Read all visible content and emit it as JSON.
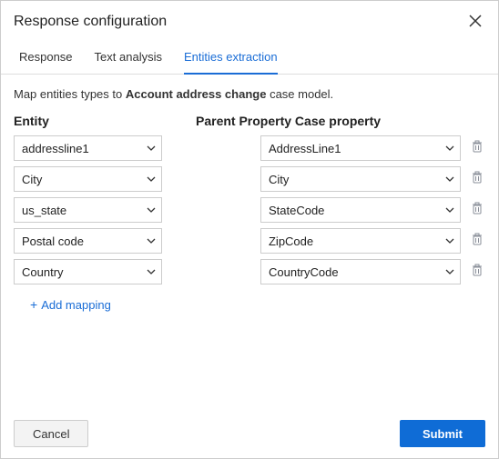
{
  "header": {
    "title": "Response configuration"
  },
  "tabs": [
    {
      "label": "Response",
      "active": false
    },
    {
      "label": "Text analysis",
      "active": false
    },
    {
      "label": "Entities extraction",
      "active": true
    }
  ],
  "body": {
    "map_text_prefix": "Map entities types to ",
    "map_text_bold": "Account address change",
    "map_text_suffix": " case model."
  },
  "columns": {
    "entity": "Entity",
    "case_property": "Parent Property Case property"
  },
  "rows": [
    {
      "entity": "addressline1",
      "case_property": "AddressLine1"
    },
    {
      "entity": "City",
      "case_property": "City"
    },
    {
      "entity": "us_state",
      "case_property": "StateCode"
    },
    {
      "entity": "Postal code",
      "case_property": "ZipCode"
    },
    {
      "entity": "Country",
      "case_property": "CountryCode"
    }
  ],
  "actions": {
    "add_mapping": "Add mapping",
    "cancel": "Cancel",
    "submit": "Submit"
  }
}
